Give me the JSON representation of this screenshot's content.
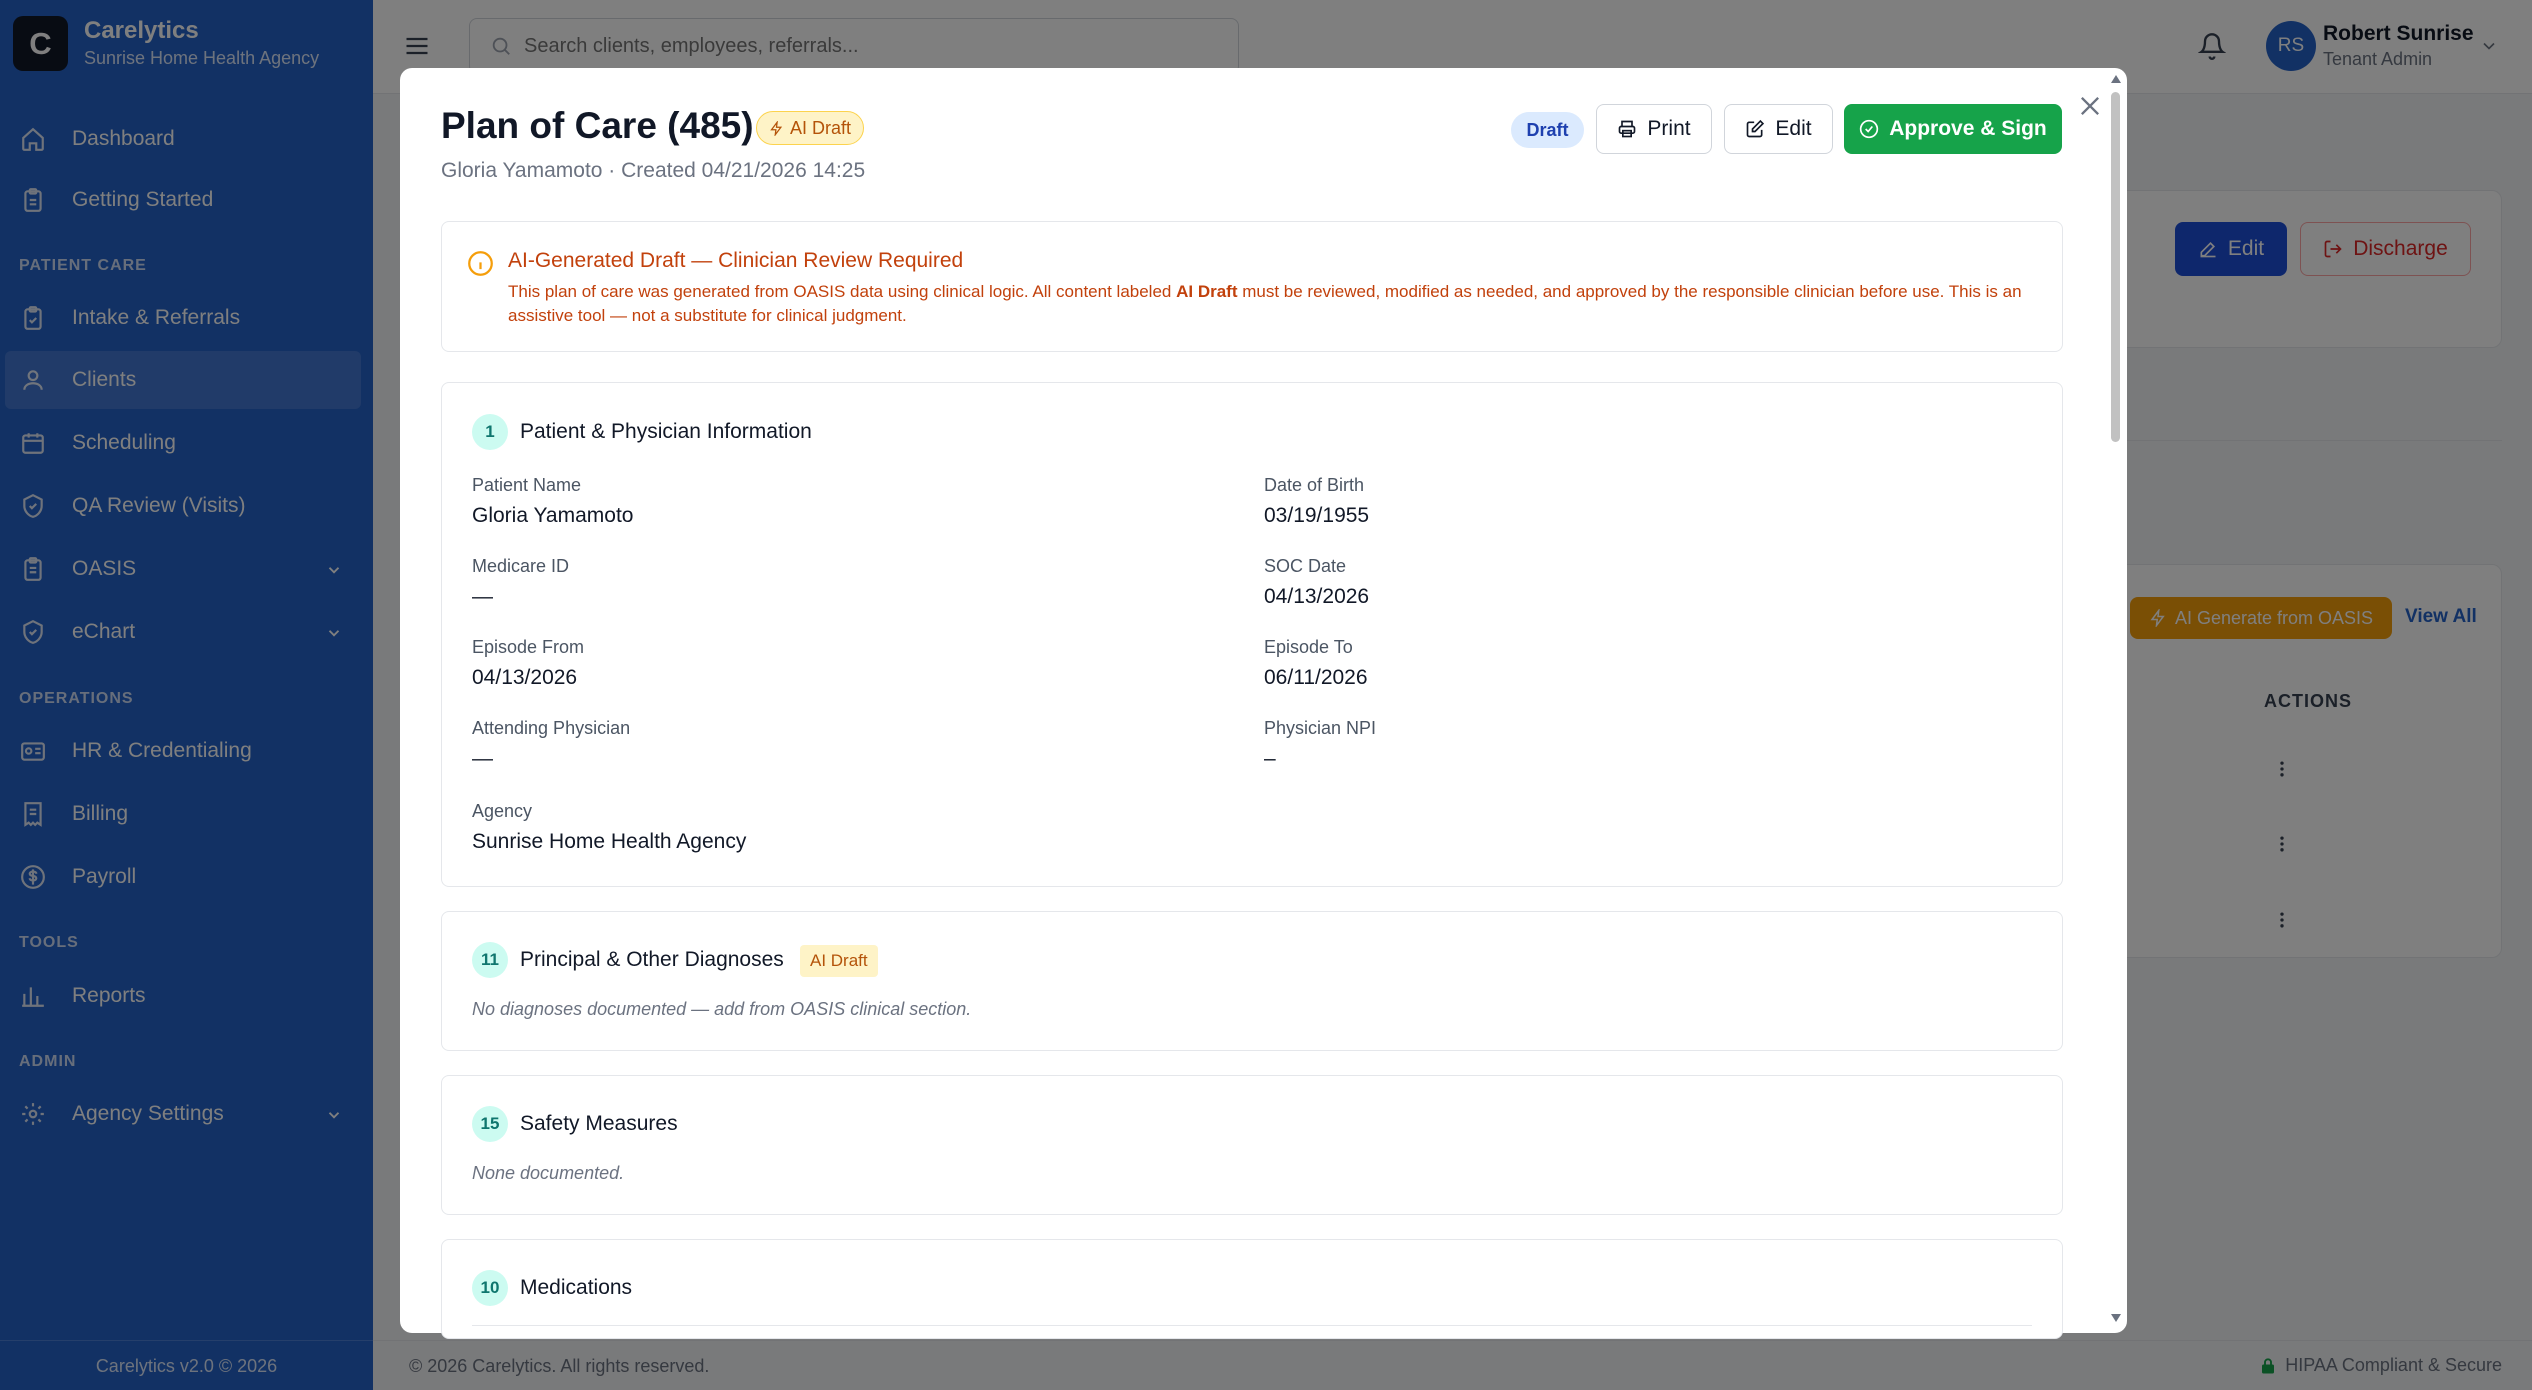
{
  "brand": {
    "logo_letter": "C",
    "name": "Carelytics",
    "agency": "Sunrise Home Health Agency"
  },
  "nav": {
    "dashboard": "Dashboard",
    "getting_started": "Getting Started",
    "section_patient_care": "PATIENT CARE",
    "intake": "Intake & Referrals",
    "clients": "Clients",
    "scheduling": "Scheduling",
    "qa_review": "QA Review (Visits)",
    "oasis": "OASIS",
    "echart": "eChart",
    "section_operations": "OPERATIONS",
    "hr": "HR & Credentialing",
    "billing": "Billing",
    "payroll": "Payroll",
    "section_tools": "TOOLS",
    "reports": "Reports",
    "section_admin": "ADMIN",
    "agency_settings": "Agency Settings",
    "active_item": "Clients"
  },
  "sidebar_footer": "Carelytics v2.0 © 2026",
  "topbar": {
    "search_placeholder": "Search clients, employees, referrals...",
    "user_initials": "RS",
    "user_name": "Robert Sunrise",
    "user_role": "Tenant Admin"
  },
  "background_page": {
    "edit_label": "Edit",
    "discharge_label": "Discharge",
    "ai_generate_label": "AI Generate from OASIS",
    "view_all_label": "View All",
    "actions_header": "ACTIONS"
  },
  "page_footer": {
    "copyright": "© 2026 Carelytics. All rights reserved.",
    "hipaa": "HIPAA Compliant & Secure"
  },
  "modal": {
    "title": "Plan of Care (485)",
    "title_badge": "AI Draft",
    "subtitle": "Gloria Yamamoto · Created 04/21/2026 14:25",
    "status": "Draft",
    "print_label": "Print",
    "edit_label": "Edit",
    "approve_label": "Approve & Sign",
    "notice": {
      "title": "AI-Generated Draft — Clinician Review Required",
      "body_pre": "This plan of care was generated from OASIS data using clinical logic. All content labeled ",
      "body_bold": "AI Draft",
      "body_post": " must be reviewed, modified as needed, and approved by the responsible clinician before use. This is an assistive tool — not a substitute for clinical judgment."
    },
    "sections": {
      "patient": {
        "number": "1",
        "title": "Patient & Physician Information",
        "fields": {
          "patient_name_label": "Patient Name",
          "patient_name": "Gloria Yamamoto",
          "dob_label": "Date of Birth",
          "dob": "03/19/1955",
          "medicare_label": "Medicare ID",
          "medicare": "—",
          "soc_label": "SOC Date",
          "soc": "04/13/2026",
          "episode_from_label": "Episode From",
          "episode_from": "04/13/2026",
          "episode_to_label": "Episode To",
          "episode_to": "06/11/2026",
          "physician_label": "Attending Physician",
          "physician": "—",
          "npi_label": "Physician NPI",
          "npi": "–",
          "agency_label": "Agency",
          "agency": "Sunrise Home Health Agency"
        }
      },
      "diagnoses": {
        "number": "11",
        "title": "Principal & Other Diagnoses",
        "badge": "AI Draft",
        "empty": "No diagnoses documented — add from OASIS clinical section."
      },
      "safety": {
        "number": "15",
        "title": "Safety Measures",
        "empty": "None documented."
      },
      "medications": {
        "number": "10",
        "title": "Medications"
      }
    }
  },
  "colors": {
    "sidebar": "#2563c9",
    "approve": "#16a34a",
    "ai_badge_bg": "#fef3c7",
    "ai_text": "#c2410c",
    "section_num_bg": "#ccfbf1"
  }
}
